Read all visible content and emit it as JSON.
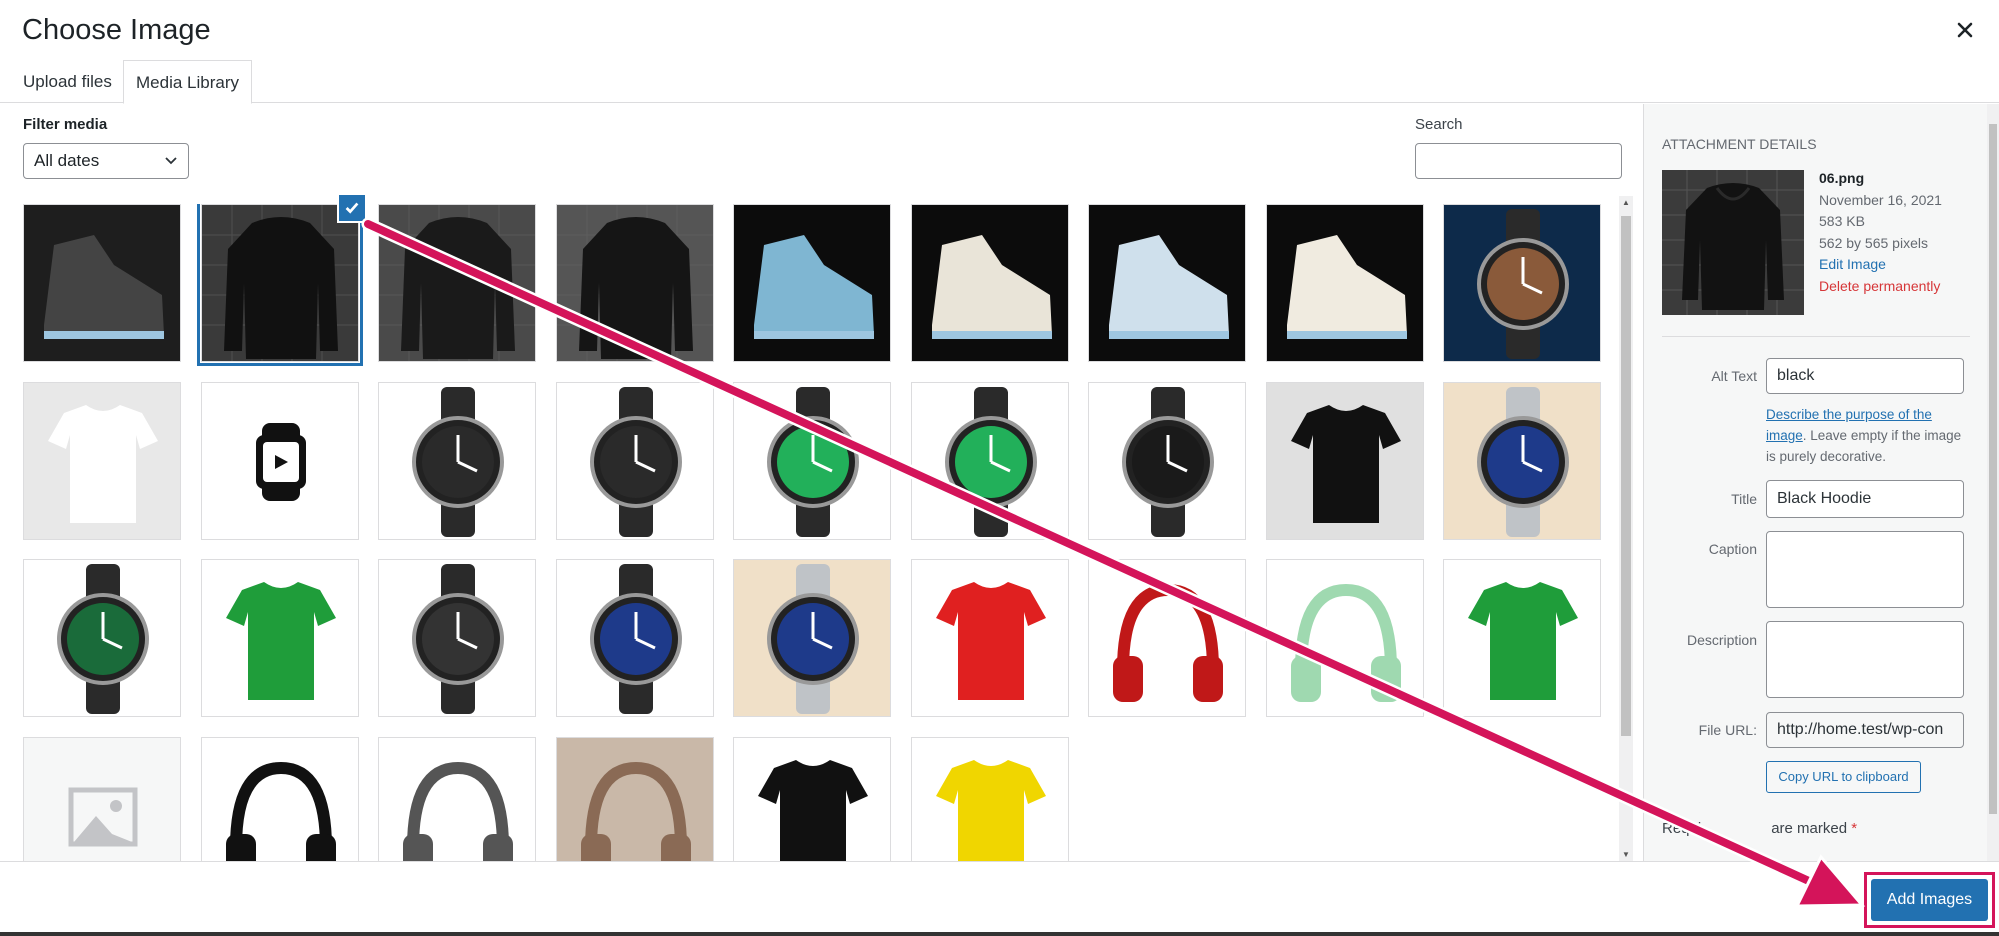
{
  "modal": {
    "title": "Choose Image"
  },
  "tabs": [
    {
      "label": "Upload files",
      "active": false
    },
    {
      "label": "Media Library",
      "active": true
    }
  ],
  "toolbar": {
    "filter_label": "Filter media",
    "date_filter_value": "All dates",
    "search_label": "Search",
    "search_value": ""
  },
  "media_items": [
    {
      "name": "sneaker-laces",
      "selected": false,
      "bg": "#1e1e1e",
      "fg": "#444"
    },
    {
      "name": "black-hoodie-06",
      "selected": true,
      "bg": "#3a3a3a",
      "fg": "#111"
    },
    {
      "name": "black-hoodie-2",
      "selected": false,
      "bg": "#4a4a4a",
      "fg": "#1a1a1a"
    },
    {
      "name": "print-hoodie",
      "selected": false,
      "bg": "#555",
      "fg": "#151515"
    },
    {
      "name": "sneaker-sole",
      "selected": false,
      "bg": "#0c0c0c",
      "fg": "#7fb6d2"
    },
    {
      "name": "white-sneakers-front",
      "selected": false,
      "bg": "#0c0c0c",
      "fg": "#e9e4d8"
    },
    {
      "name": "white-sneakers-back",
      "selected": false,
      "bg": "#0c0c0c",
      "fg": "#cfe0ec"
    },
    {
      "name": "white-high-top",
      "selected": false,
      "bg": "#0c0c0c",
      "fg": "#f0ebe0"
    },
    {
      "name": "chronograph-watch",
      "selected": false,
      "bg": "#0d2a4a",
      "fg": "#8a5a3a"
    },
    {
      "name": "white-tshirt",
      "selected": false,
      "bg": "#e8e8e8",
      "fg": "#ffffff"
    },
    {
      "name": "watch-icon",
      "selected": false,
      "bg": "#ffffff",
      "fg": "#111111"
    },
    {
      "name": "smartwatch-side",
      "selected": false,
      "bg": "#ffffff",
      "fg": "#2a2a2a"
    },
    {
      "name": "galaxy-watch-back",
      "selected": false,
      "bg": "#ffffff",
      "fg": "#2a2a2a"
    },
    {
      "name": "galaxy-watch-green",
      "selected": false,
      "bg": "#ffffff",
      "fg": "#22b05a"
    },
    {
      "name": "galaxy-watch-face",
      "selected": false,
      "bg": "#ffffff",
      "fg": "#22b05a"
    },
    {
      "name": "nixon-watch",
      "selected": false,
      "bg": "#ffffff",
      "fg": "#1a1a1a"
    },
    {
      "name": "nc-tshirt",
      "selected": false,
      "bg": "#e0e0e0",
      "fg": "#111111"
    },
    {
      "name": "steel-watch-blue",
      "selected": false,
      "bg": "#f0e0c8",
      "fg": "#1e3a8a"
    },
    {
      "name": "green-leather-watch",
      "selected": false,
      "bg": "#ffffff",
      "fg": "#1a6b3a"
    },
    {
      "name": "green-tshirt",
      "selected": false,
      "bg": "#ffffff",
      "fg": "#1f9d3a"
    },
    {
      "name": "digital-sport-watch",
      "selected": false,
      "bg": "#ffffff",
      "fg": "#333333"
    },
    {
      "name": "watch-collection",
      "selected": false,
      "bg": "#ffffff",
      "fg": "#1e3a8a"
    },
    {
      "name": "steel-watch-blue-2",
      "selected": false,
      "bg": "#f0e0c8",
      "fg": "#1e3a8a"
    },
    {
      "name": "red-tshirt",
      "selected": false,
      "bg": "#ffffff",
      "fg": "#e02020"
    },
    {
      "name": "red-headphones",
      "selected": false,
      "bg": "#ffffff",
      "fg": "#c01818"
    },
    {
      "name": "green-headphones",
      "selected": false,
      "bg": "#ffffff",
      "fg": "#9fd9b0"
    },
    {
      "name": "green-tshirt-2",
      "selected": false,
      "bg": "#ffffff",
      "fg": "#1f9d3a"
    },
    {
      "name": "image-placeholder",
      "selected": false,
      "bg": "#f6f7f7",
      "fg": "#c3c4c7"
    },
    {
      "name": "black-headphones",
      "selected": false,
      "bg": "#ffffff",
      "fg": "#111111"
    },
    {
      "name": "bone-conduction-headset",
      "selected": false,
      "bg": "#ffffff",
      "fg": "#555555"
    },
    {
      "name": "woman-headphones",
      "selected": false,
      "bg": "#c9b8a8",
      "fg": "#8a6a55"
    },
    {
      "name": "black-tshirt",
      "selected": false,
      "bg": "#ffffff",
      "fg": "#111111"
    },
    {
      "name": "yellow-tshirt",
      "selected": false,
      "bg": "#ffffff",
      "fg": "#f0d600"
    }
  ],
  "attachment": {
    "heading": "ATTACHMENT DETAILS",
    "filename": "06.png",
    "date": "November 16, 2021",
    "filesize": "583 KB",
    "dimensions": "562 by 565 pixels",
    "edit_link": "Edit Image",
    "delete_link": "Delete permanently",
    "alt_label": "Alt Text",
    "alt_value": "black",
    "alt_help_link": "Describe the purpose of the image",
    "alt_help_text": ". Leave empty if the image is purely decorative.",
    "title_label": "Title",
    "title_value": "Black Hoodie",
    "caption_label": "Caption",
    "caption_value": "",
    "description_label": "Description",
    "description_value": "",
    "file_url_label": "File URL:",
    "file_url_value": "http://home.test/wp-con",
    "copy_button": "Copy URL to clipboard",
    "required_note_start": "Requi",
    "required_note_end": "are marked",
    "required_star": "*"
  },
  "footer": {
    "add_button": "Add Images"
  },
  "colors": {
    "accent": "#2271b1",
    "highlight": "#d4145a",
    "danger": "#d63638"
  }
}
